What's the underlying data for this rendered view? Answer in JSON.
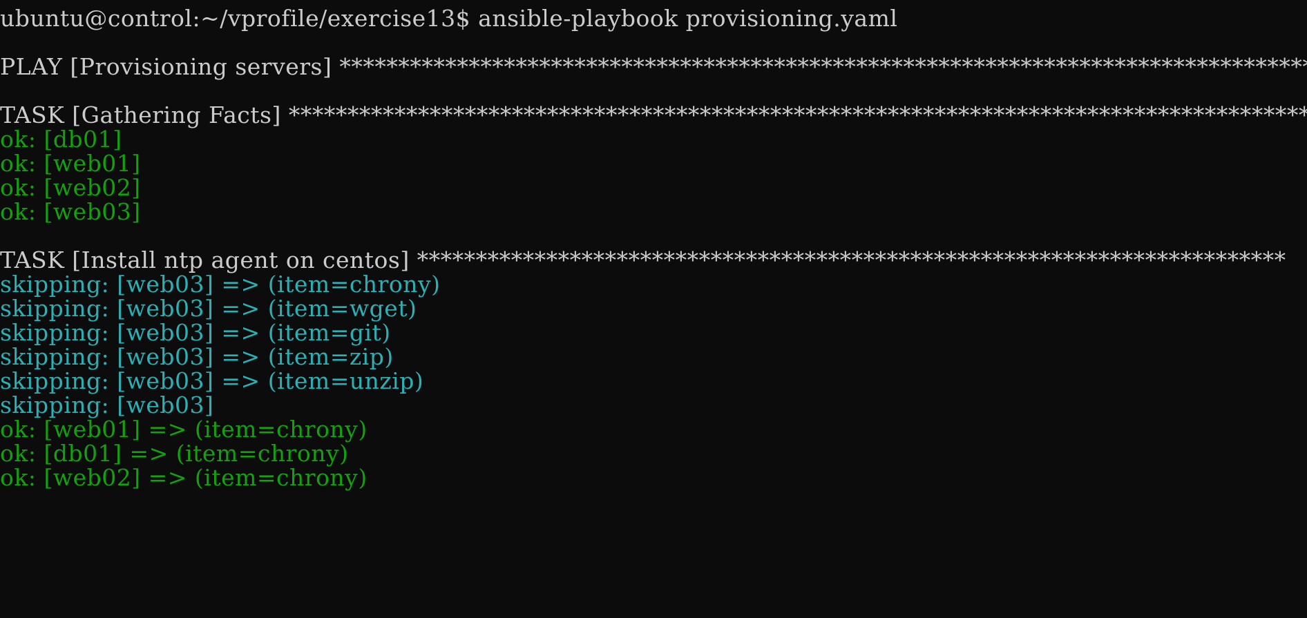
{
  "terminal": {
    "scrollback_fragment": "  ·   · · · · ·  · ·  · · ·    · ·  ·  · · · ·  · · ·",
    "prompt": "ubuntu@control:~/vprofile/exercise13$ ansible-playbook provisioning.yaml",
    "play_header": "PLAY [Provisioning servers] *************************************************************************************",
    "task1_header": "TASK [Gathering Facts] ******************************************************************************************",
    "task1_results": [
      "ok: [db01]",
      "ok: [web01]",
      "ok: [web02]",
      "ok: [web03]"
    ],
    "task2_header": "TASK [Install ntp agent on centos] **************************************************************************",
    "task2_skips": [
      "skipping: [web03] => (item=chrony)",
      "skipping: [web03] => (item=wget)",
      "skipping: [web03] => (item=git)",
      "skipping: [web03] => (item=zip)",
      "skipping: [web03] => (item=unzip)",
      "skipping: [web03]"
    ],
    "task2_oks": [
      "ok: [web01] => (item=chrony)",
      "ok: [db01] => (item=chrony)",
      "ok: [web02] => (item=chrony)"
    ]
  },
  "colors": {
    "background": "#0c0c0c",
    "default_text": "#cccccc",
    "ok": "#13a10e",
    "skipping": "#2bb0b6"
  }
}
